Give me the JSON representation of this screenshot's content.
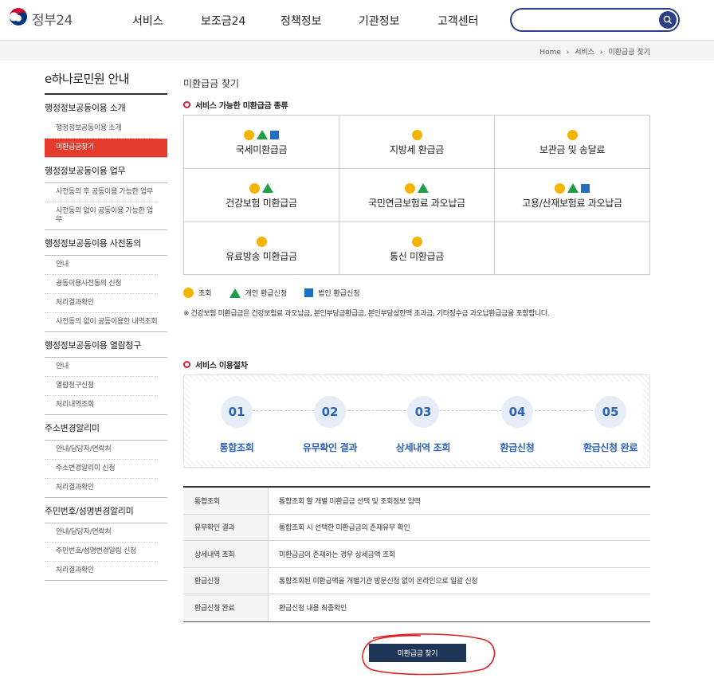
{
  "header": {
    "logo_text": "정부24",
    "nav": [
      "서비스",
      "보조금24",
      "정책정보",
      "기관정보",
      "고객센터"
    ],
    "search_placeholder": ""
  },
  "breadcrumb": [
    "Home",
    "서비스",
    "미환급금 찾기"
  ],
  "sidebar": {
    "title": "e하나로민원 안내",
    "groups": [
      {
        "head": "행정정보공동이용 소개",
        "items": [
          "행정정보공동이용 소개",
          "미환급금찾기"
        ]
      },
      {
        "head": "행정정보공동이용 업무",
        "items": [
          "사전동의 후 공동이용 가능한 업무",
          "사전동의 없이 공동이용 가능한 업무"
        ]
      },
      {
        "head": "행정정보공동이용 사전동의",
        "items": [
          "안내",
          "공동이용사전동의 신청",
          "처리결과확인",
          "사전동의 없이 공동이용한 내역조회"
        ]
      },
      {
        "head": "행정정보공동이용 열람청구",
        "items": [
          "안내",
          "열람청구신청",
          "처리내역조회"
        ]
      },
      {
        "head": "주소변경알리미",
        "items": [
          "안내/담당자/연락처",
          "주소변경알리미 신청",
          "처리결과확인"
        ]
      },
      {
        "head": "주민번호/성명변경알리미",
        "items": [
          "안내/담당자/연락처",
          "주민번호/성명변경알림 신청",
          "처리결과확인"
        ]
      }
    ]
  },
  "content": {
    "page_title": "미환급금 찾기",
    "section1_title": "서비스 가능한 미환급금 종류",
    "refund_types": [
      {
        "label": "국세미환급금",
        "marks": [
          "circle",
          "triangle",
          "square"
        ]
      },
      {
        "label": "지방세 환급금",
        "marks": [
          "circle"
        ]
      },
      {
        "label": "보관금 및 송달료",
        "marks": [
          "circle"
        ]
      },
      {
        "label": "건강보험 미환급금",
        "marks": [
          "circle",
          "triangle"
        ]
      },
      {
        "label": "국민연금보험료 과오납금",
        "marks": [
          "circle",
          "triangle"
        ]
      },
      {
        "label": "고용/산재보험료 과오납금",
        "marks": [
          "circle",
          "triangle",
          "square"
        ]
      },
      {
        "label": "유료방송 미환급금",
        "marks": [
          "circle"
        ]
      },
      {
        "label": "통신 미환급금",
        "marks": [
          "circle"
        ]
      },
      {
        "label": "",
        "marks": []
      }
    ],
    "legend": {
      "circle": "조회",
      "triangle": "개인 환급신청",
      "square": "법인 환급신청"
    },
    "note": "※ 건강보험 미환급금은 건강보험료 과오납금, 본인부담금환급금, 본인부담상한액 초과금, 기타징수금 과오납환급금을 포함합니다.",
    "section2_title": "서비스 이용절차",
    "steps": [
      {
        "num": "01",
        "label": "통합조회"
      },
      {
        "num": "02",
        "label": "유무확인 결과"
      },
      {
        "num": "03",
        "label": "상세내역 조회"
      },
      {
        "num": "04",
        "label": "환급신청"
      },
      {
        "num": "05",
        "label": "환급신청 완료"
      }
    ],
    "table": [
      {
        "k": "통합조회",
        "v": "통합조회 할 개별 미환급금 선택 및 조회정보 입력"
      },
      {
        "k": "유무확인 결과",
        "v": "통합조회 시 선택한 미환급금의 존재유무 확인"
      },
      {
        "k": "상세내역 조회",
        "v": "미환급금이 존재하는 경우 상세금액 조회"
      },
      {
        "k": "환급신청",
        "v": "통합조회된 미환급액을 개별기관 방문신청 없이 온라인으로 일괄 신청"
      },
      {
        "k": "환급신청 완료",
        "v": "환급신청 내용 최종확인"
      }
    ],
    "find_button": "미환급금 찾기"
  },
  "colors": {
    "accent_red": "#e53b2c",
    "navy": "#2b3f84",
    "circle": "#f5b400",
    "triangle": "#1f9e47",
    "square": "#1f6fc2",
    "step_blue": "#2e63b8"
  }
}
